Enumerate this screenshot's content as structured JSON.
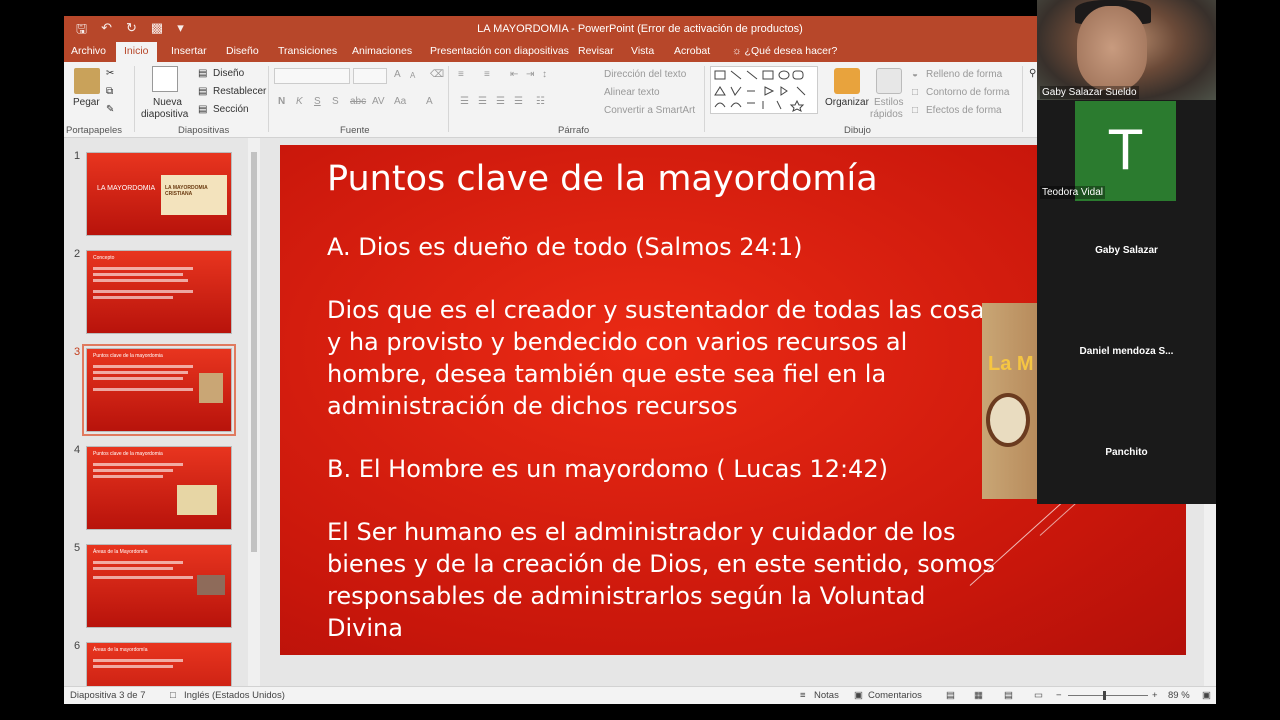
{
  "window": {
    "title": "LA MAYORDOMIA - PowerPoint (Error de activación de productos)"
  },
  "tabs": [
    "Archivo",
    "Inicio",
    "Insertar",
    "Diseño",
    "Transiciones",
    "Animaciones",
    "Presentación con diapositivas",
    "Revisar",
    "Vista",
    "Acrobat"
  ],
  "tell_me": "¿Qué desea hacer?",
  "ribbon": {
    "portapapeles": {
      "label": "Portapapeles",
      "paste": "Pegar"
    },
    "diapositivas": {
      "label": "Diapositivas",
      "new_slide_1": "Nueva",
      "new_slide_2": "diapositiva",
      "layout": "Diseño",
      "reset": "Restablecer",
      "section": "Sección"
    },
    "fuente": {
      "label": "Fuente",
      "bold": "N",
      "italic": "K",
      "underline": "S",
      "shadow": "S",
      "strike": "abc",
      "spacing": "AV",
      "case": "Aa",
      "color": "A",
      "grow": "A",
      "shrink": "A"
    },
    "parrafo": {
      "label": "Párrafo",
      "text_direction": "Dirección del texto",
      "align_text": "Alinear texto",
      "smartart": "Convertir a SmartArt"
    },
    "dibujo": {
      "label": "Dibujo",
      "arrange": "Organizar",
      "quick_styles_1": "Estilos",
      "quick_styles_2": "rápidos",
      "fill": "Relleno de forma",
      "outline": "Contorno de forma",
      "effects": "Efectos de forma"
    }
  },
  "thumbnails": [
    {
      "num": "1",
      "title": "LA MAYORDOMIA",
      "sub": "LA MAYORDOMIA CRISTIANA"
    },
    {
      "num": "2",
      "title": "Concepto"
    },
    {
      "num": "3",
      "title": "Puntos clave de la mayordomia"
    },
    {
      "num": "4",
      "title": "Puntos clave de la mayordomia"
    },
    {
      "num": "5",
      "title": "Áreas de la Mayordomía"
    },
    {
      "num": "6",
      "title": "Áreas de la mayordomía"
    }
  ],
  "slide": {
    "title": "Puntos clave de la mayordomía",
    "p1": "A.  Dios es dueño de todo (Salmos 24:1)",
    "p2": "Dios que es el creador y sustentador de todas las cosas y ha provisto y bendecido con varios recursos al hombre, desea también que este sea fiel en la administración de dichos recursos",
    "p3": "B. El Hombre es un mayordomo ( Lucas 12:42)",
    "p4": "El Ser humano es el administrador y cuidador de los bienes y de la creación de Dios, en este sentido, somos responsables de administrarlos según la Voluntad Divina",
    "pic_text": "La M"
  },
  "status": {
    "slide_info": "Diapositiva 3 de 7",
    "language": "Inglés (Estados Unidos)",
    "notes": "Notas",
    "comments": "Comentarios",
    "zoom": "89 %"
  },
  "video": {
    "p1": "Gaby Salazar Sueldo",
    "p2": "Teodora Vidal",
    "p2_initial": "T",
    "p3": "Gaby Salazar",
    "p4": "Daniel  mendoza  S...",
    "p5": "Panchito"
  }
}
